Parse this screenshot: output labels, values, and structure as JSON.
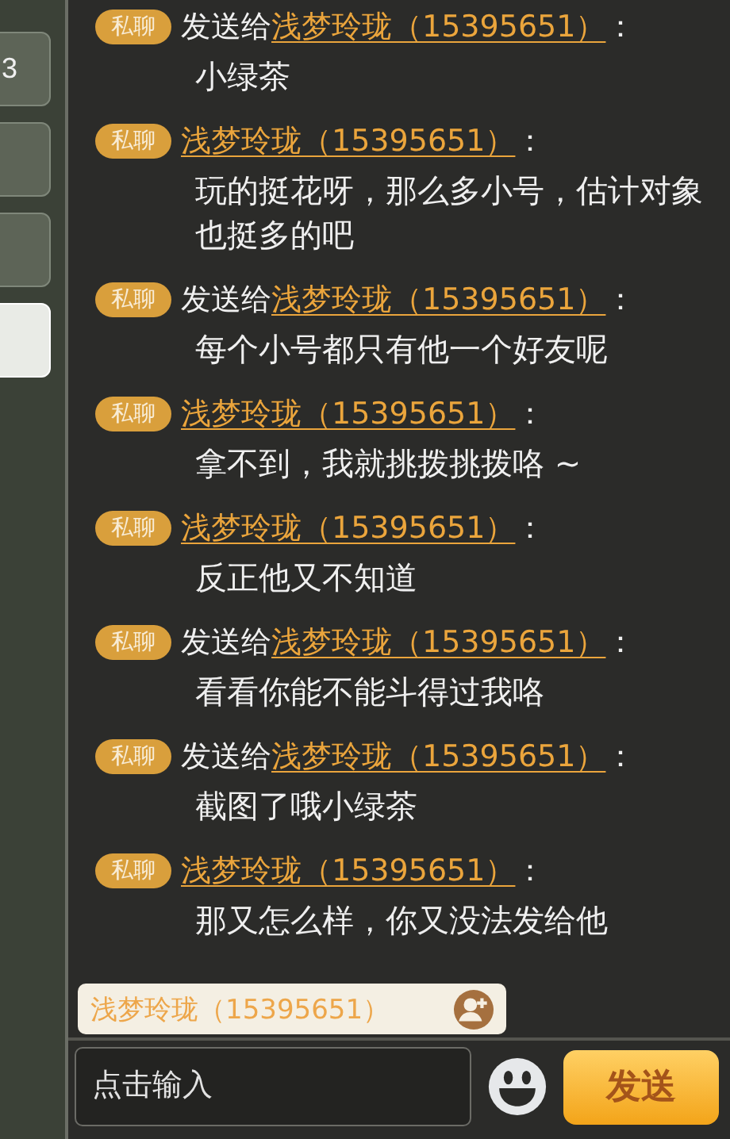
{
  "sidebar": {
    "tabs": [
      {
        "label": "3",
        "selected": false
      },
      {
        "selected": false
      },
      {
        "selected": false
      },
      {
        "selected": true
      }
    ]
  },
  "messages": [
    {
      "kind": "sent",
      "badge": "私聊",
      "prefix": "发送给",
      "name": "浅梦玲珑（15395651）",
      "colon": "：",
      "body": "小绿茶"
    },
    {
      "kind": "received",
      "badge": "私聊",
      "name": "浅梦玲珑（15395651）",
      "colon": "：",
      "body": "玩的挺花呀，那么多小号，估计对象也挺多的吧"
    },
    {
      "kind": "sent",
      "badge": "私聊",
      "prefix": "发送给",
      "name": "浅梦玲珑（15395651）",
      "colon": "：",
      "body": "每个小号都只有他一个好友呢"
    },
    {
      "kind": "received",
      "badge": "私聊",
      "name": "浅梦玲珑（15395651）",
      "colon": "：",
      "body": "拿不到，我就挑拨挑拨咯 ~"
    },
    {
      "kind": "received",
      "badge": "私聊",
      "name": "浅梦玲珑（15395651）",
      "colon": "：",
      "body": "反正他又不知道"
    },
    {
      "kind": "sent",
      "badge": "私聊",
      "prefix": "发送给",
      "name": "浅梦玲珑（15395651）",
      "colon": "：",
      "body": "看看你能不能斗得过我咯"
    },
    {
      "kind": "sent",
      "badge": "私聊",
      "prefix": "发送给",
      "name": "浅梦玲珑（15395651）",
      "colon": "：",
      "body": "截图了哦小绿茶"
    },
    {
      "kind": "received",
      "badge": "私聊",
      "name": "浅梦玲珑（15395651）",
      "colon": "：",
      "body": "那又怎么样，你又没法发给他"
    }
  ],
  "recipient": {
    "name": "浅梦玲珑（15395651）"
  },
  "input": {
    "placeholder": "点击输入"
  },
  "send_button": "发送"
}
